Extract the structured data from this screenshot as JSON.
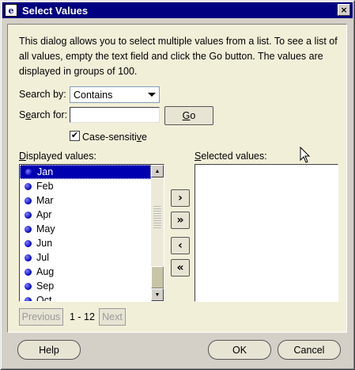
{
  "window": {
    "title": "Select Values",
    "close_glyph": "×"
  },
  "intro": "This dialog allows you to select multiple values from a list. To see a list of all values, empty the text field and click the Go button. The values are displayed in groups of 100.",
  "search_by": {
    "label_prefix": "Search by:",
    "value": "Contains"
  },
  "search_for": {
    "label_pre": "S",
    "label_ul": "e",
    "label_post": "arch for:",
    "value": "",
    "go_ul": "G",
    "go_post": "o"
  },
  "case_sensitive": {
    "checked": true,
    "check_glyph": "✔",
    "label_pre": "Case-sensiti",
    "label_ul": "v",
    "label_post": "e"
  },
  "displayed": {
    "label_ul": "D",
    "label_post": "isplayed values:",
    "items": [
      "Jan",
      "Feb",
      "Mar",
      "Apr",
      "May",
      "Jun",
      "Jul",
      "Aug",
      "Sep",
      "Oct"
    ],
    "selected_index": 0
  },
  "selected": {
    "label_ul": "S",
    "label_post": "elected values:"
  },
  "move_buttons": {
    "move": "›",
    "move_all": "»",
    "remove": "‹",
    "remove_all": "«"
  },
  "pager": {
    "previous": "Previous",
    "range": "1 - 12",
    "next": "Next"
  },
  "footer": {
    "help": "Help",
    "ok": "OK",
    "cancel": "Cancel"
  },
  "colors": {
    "titlebar": "#000080",
    "panel": "#f2efd9",
    "selection": "#0000b0"
  }
}
